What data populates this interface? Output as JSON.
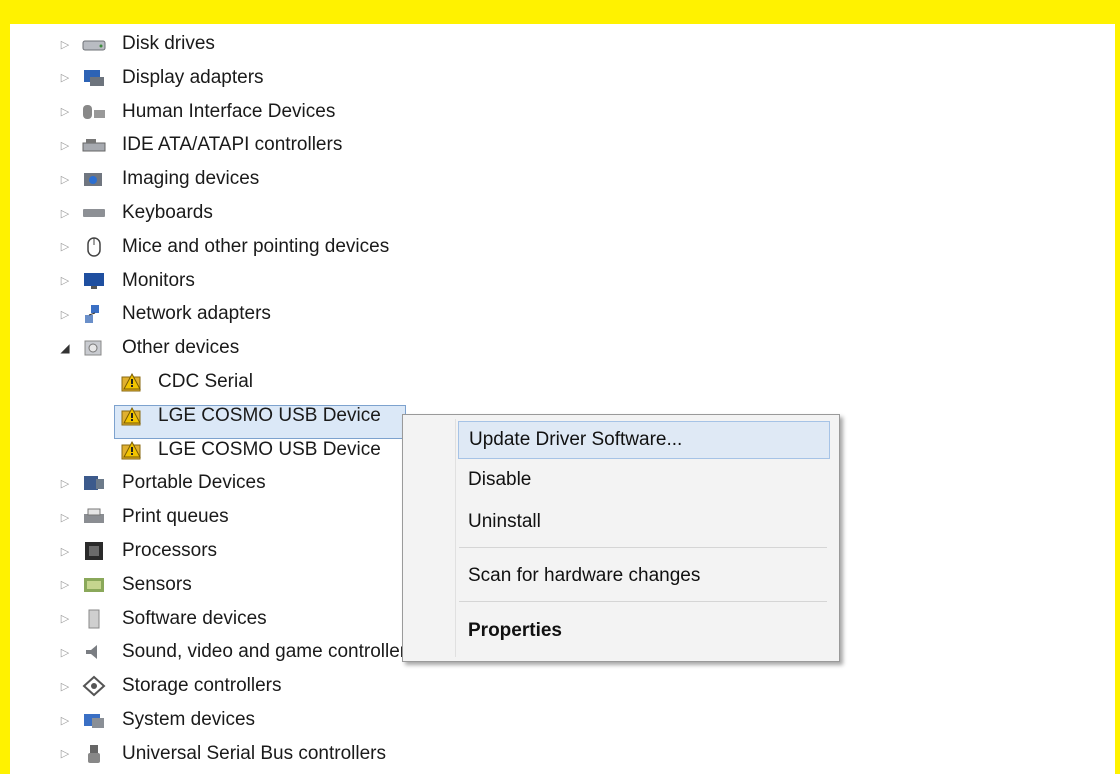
{
  "device_tree": {
    "categories_before": [
      {
        "label": "Disk drives",
        "icon": "disk-drive-icon"
      },
      {
        "label": "Display adapters",
        "icon": "display-adapter-icon"
      },
      {
        "label": "Human Interface Devices",
        "icon": "hid-icon"
      },
      {
        "label": "IDE ATA/ATAPI controllers",
        "icon": "ide-controller-icon"
      },
      {
        "label": "Imaging devices",
        "icon": "imaging-device-icon"
      },
      {
        "label": "Keyboards",
        "icon": "keyboard-icon"
      },
      {
        "label": "Mice and other pointing devices",
        "icon": "mouse-icon"
      },
      {
        "label": "Monitors",
        "icon": "monitor-icon"
      },
      {
        "label": "Network adapters",
        "icon": "network-adapter-icon"
      }
    ],
    "expanded_category": {
      "label": "Other devices",
      "icon": "other-devices-icon"
    },
    "expanded_children": [
      {
        "label": "CDC Serial",
        "icon": "warning-device-icon"
      },
      {
        "label": "LGE COSMO USB Device",
        "icon": "warning-device-icon",
        "selected": true
      },
      {
        "label": "LGE COSMO USB Device",
        "icon": "warning-device-icon"
      }
    ],
    "categories_after": [
      {
        "label": "Portable Devices",
        "icon": "portable-device-icon"
      },
      {
        "label": "Print queues",
        "icon": "printer-icon"
      },
      {
        "label": "Processors",
        "icon": "processor-icon"
      },
      {
        "label": "Sensors",
        "icon": "sensor-icon"
      },
      {
        "label": "Software devices",
        "icon": "software-device-icon"
      },
      {
        "label": "Sound, video and game controllers",
        "icon": "sound-icon"
      },
      {
        "label": "Storage controllers",
        "icon": "storage-controller-icon"
      },
      {
        "label": "System devices",
        "icon": "system-device-icon"
      },
      {
        "label": "Universal Serial Bus controllers",
        "icon": "usb-icon"
      }
    ]
  },
  "context_menu": {
    "update_driver": "Update Driver Software...",
    "disable": "Disable",
    "uninstall": "Uninstall",
    "scan": "Scan for hardware changes",
    "properties": "Properties"
  },
  "colors": {
    "frame": "#fff200",
    "selection": "#dbe8f7",
    "menu_highlight": "#dfe9f5"
  }
}
